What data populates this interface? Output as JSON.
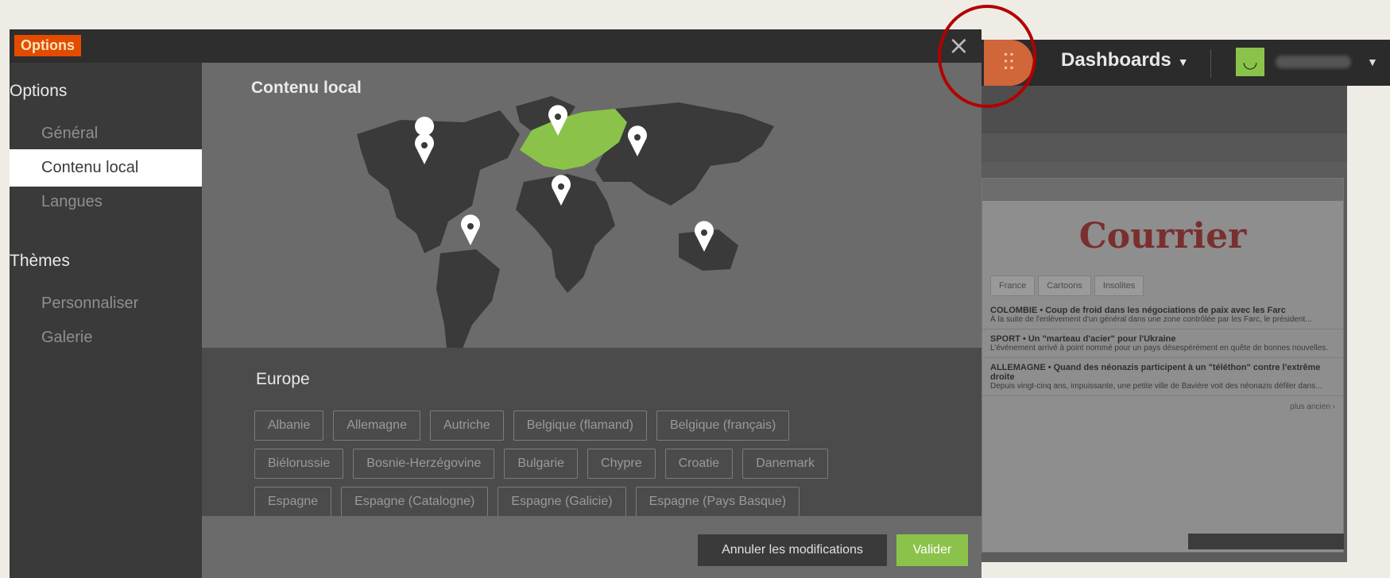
{
  "modal": {
    "title_tag": "Options",
    "close_glyph": "×",
    "sidebar": {
      "section1": "Options",
      "items1": [
        {
          "label": "Général",
          "active": false
        },
        {
          "label": "Contenu local",
          "active": true
        },
        {
          "label": "Langues",
          "active": false
        }
      ],
      "section2": "Thèmes",
      "items2": [
        {
          "label": "Personnaliser"
        },
        {
          "label": "Galerie"
        }
      ]
    },
    "content_title": "Contenu local",
    "region_title": "Europe",
    "countries": [
      "Albanie",
      "Allemagne",
      "Autriche",
      "Belgique (flamand)",
      "Belgique (français)",
      "Biélorussie",
      "Bosnie-Herzégovine",
      "Bulgarie",
      "Chypre",
      "Croatie",
      "Danemark",
      "Espagne",
      "Espagne (Catalogne)",
      "Espagne (Galicie)",
      "Espagne (Pays Basque)"
    ],
    "cancel_label": "Annuler les modifications",
    "ok_label": "Valider"
  },
  "background_app": {
    "dashboards_label": "Dashboards",
    "widget_logo": "Courrier",
    "widget_tabs": [
      "France",
      "Cartoons",
      "Insolites"
    ],
    "news": [
      {
        "headline": "COLOMBIE • Coup de froid dans les négociations de paix avec les Farc",
        "summary": "À la suite de l'enlèvement d'un général dans une zone contrôlée par les Farc, le président..."
      },
      {
        "headline": "SPORT • Un \"marteau d'acier\" pour l'Ukraine",
        "summary": "L'événement arrivé à point nommé pour un pays désespérément en quête de bonnes nouvelles."
      },
      {
        "headline": "ALLEMAGNE • Quand des néonazis participent à un \"téléthon\" contre l'extrême droite",
        "summary": "Depuis vingt-cinq ans, impuissante, une petite ville de Bavière voit des néonazis défiler dans..."
      }
    ],
    "more_link": "plus ancien",
    "accent_colors": {
      "map_highlight": "#8bc34a",
      "title_tag": "#e34b00",
      "logo_bg": "#d0663a",
      "annotation": "#b30000"
    }
  },
  "icons": {
    "map_pins": [
      "north-america-pin",
      "europe-pin",
      "asia-pin",
      "africa-pin",
      "south-america-pin",
      "oceania-pin"
    ]
  }
}
